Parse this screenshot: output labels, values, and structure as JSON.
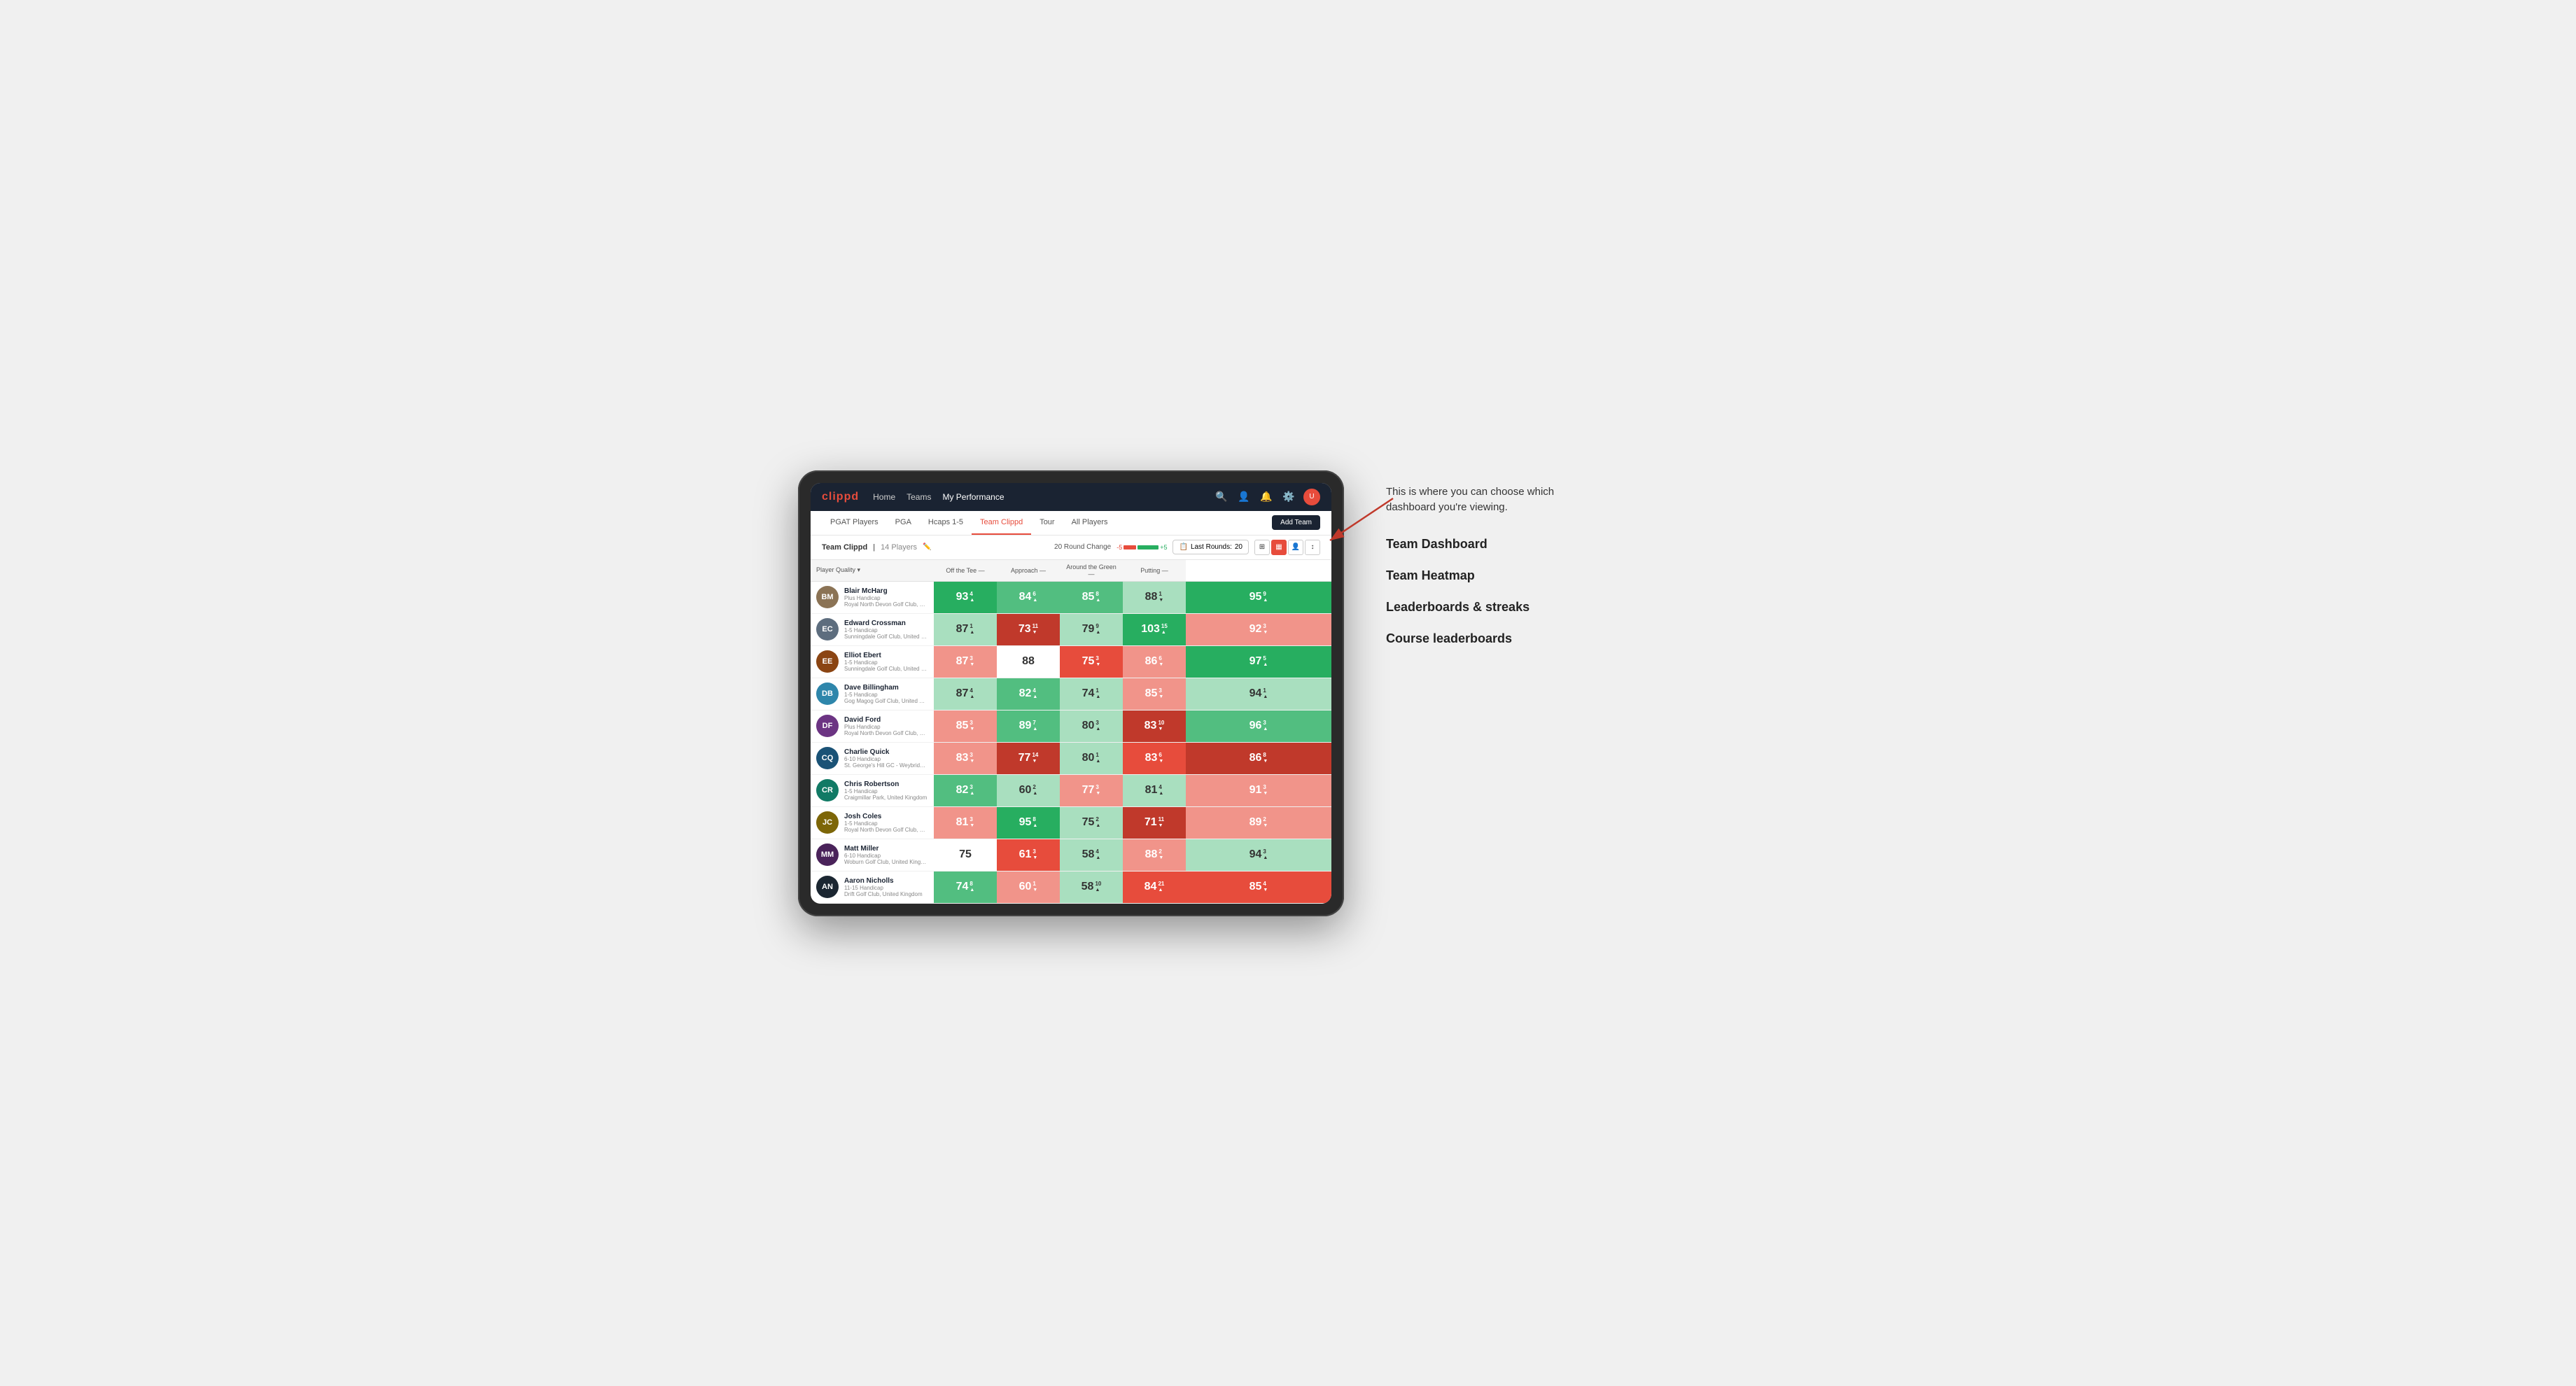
{
  "annotation": {
    "intro": "This is where you can choose which dashboard you're viewing.",
    "items": [
      "Team Dashboard",
      "Team Heatmap",
      "Leaderboards & streaks",
      "Course leaderboards"
    ]
  },
  "nav": {
    "logo": "clippd",
    "links": [
      "Home",
      "Teams",
      "My Performance"
    ],
    "active_link": "My Performance"
  },
  "sub_nav": {
    "items": [
      "PGAT Players",
      "PGA",
      "Hcaps 1-5",
      "Team Clippd",
      "Tour",
      "All Players"
    ],
    "active": "Team Clippd",
    "add_team": "Add Team"
  },
  "team_header": {
    "name": "Team Clippd",
    "separator": "|",
    "count": "14 Players",
    "round_change_label": "20 Round Change",
    "neg_val": "-5",
    "pos_val": "+5",
    "last_rounds_label": "Last Rounds:",
    "last_rounds_val": "20"
  },
  "table": {
    "columns": [
      "Player Quality ▾",
      "Off the Tee —",
      "Approach —",
      "Around the Green —",
      "Putting —"
    ],
    "rows": [
      {
        "name": "Blair McHarg",
        "handicap": "Plus Handicap",
        "club": "Royal North Devon Golf Club, United Kingdom",
        "avatar_color": "#8B7355",
        "initials": "BM",
        "metrics": [
          {
            "value": "93",
            "change": "4",
            "dir": "up",
            "bg": "green-strong"
          },
          {
            "value": "84",
            "change": "6",
            "dir": "up",
            "bg": "green-medium"
          },
          {
            "value": "85",
            "change": "8",
            "dir": "up",
            "bg": "green-medium"
          },
          {
            "value": "88",
            "change": "1",
            "dir": "down",
            "bg": "green-light"
          },
          {
            "value": "95",
            "change": "9",
            "dir": "up",
            "bg": "green-strong"
          }
        ]
      },
      {
        "name": "Edward Crossman",
        "handicap": "1-5 Handicap",
        "club": "Sunningdale Golf Club, United Kingdom",
        "avatar_color": "#5D6D7E",
        "initials": "EC",
        "metrics": [
          {
            "value": "87",
            "change": "1",
            "dir": "up",
            "bg": "green-light"
          },
          {
            "value": "73",
            "change": "11",
            "dir": "down",
            "bg": "red-strong"
          },
          {
            "value": "79",
            "change": "9",
            "dir": "up",
            "bg": "green-light"
          },
          {
            "value": "103",
            "change": "15",
            "dir": "up",
            "bg": "green-strong"
          },
          {
            "value": "92",
            "change": "3",
            "dir": "down",
            "bg": "red-light"
          }
        ]
      },
      {
        "name": "Elliot Ebert",
        "handicap": "1-5 Handicap",
        "club": "Sunningdale Golf Club, United Kingdom",
        "avatar_color": "#8B4513",
        "initials": "EE",
        "metrics": [
          {
            "value": "87",
            "change": "3",
            "dir": "down",
            "bg": "red-light"
          },
          {
            "value": "88",
            "change": "",
            "dir": "none",
            "bg": "white"
          },
          {
            "value": "75",
            "change": "3",
            "dir": "down",
            "bg": "red-medium"
          },
          {
            "value": "86",
            "change": "6",
            "dir": "down",
            "bg": "red-light"
          },
          {
            "value": "97",
            "change": "5",
            "dir": "up",
            "bg": "green-strong"
          }
        ]
      },
      {
        "name": "Dave Billingham",
        "handicap": "1-5 Handicap",
        "club": "Gog Magog Golf Club, United Kingdom",
        "avatar_color": "#2E86AB",
        "initials": "DB",
        "metrics": [
          {
            "value": "87",
            "change": "4",
            "dir": "up",
            "bg": "green-light"
          },
          {
            "value": "82",
            "change": "4",
            "dir": "up",
            "bg": "green-medium"
          },
          {
            "value": "74",
            "change": "1",
            "dir": "up",
            "bg": "green-light"
          },
          {
            "value": "85",
            "change": "3",
            "dir": "down",
            "bg": "red-light"
          },
          {
            "value": "94",
            "change": "1",
            "dir": "up",
            "bg": "green-light"
          }
        ]
      },
      {
        "name": "David Ford",
        "handicap": "Plus Handicap",
        "club": "Royal North Devon Golf Club, United Kingdom",
        "avatar_color": "#6C3483",
        "initials": "DF",
        "metrics": [
          {
            "value": "85",
            "change": "3",
            "dir": "down",
            "bg": "red-light"
          },
          {
            "value": "89",
            "change": "7",
            "dir": "up",
            "bg": "green-medium"
          },
          {
            "value": "80",
            "change": "3",
            "dir": "up",
            "bg": "green-light"
          },
          {
            "value": "83",
            "change": "10",
            "dir": "down",
            "bg": "red-strong"
          },
          {
            "value": "96",
            "change": "3",
            "dir": "up",
            "bg": "green-medium"
          }
        ]
      },
      {
        "name": "Charlie Quick",
        "handicap": "6-10 Handicap",
        "club": "St. George's Hill GC - Weybridge, Surrey, Uni...",
        "avatar_color": "#1A5276",
        "initials": "CQ",
        "metrics": [
          {
            "value": "83",
            "change": "3",
            "dir": "down",
            "bg": "red-light"
          },
          {
            "value": "77",
            "change": "14",
            "dir": "down",
            "bg": "red-strong"
          },
          {
            "value": "80",
            "change": "1",
            "dir": "up",
            "bg": "green-light"
          },
          {
            "value": "83",
            "change": "6",
            "dir": "down",
            "bg": "red-medium"
          },
          {
            "value": "86",
            "change": "8",
            "dir": "down",
            "bg": "red-strong"
          }
        ]
      },
      {
        "name": "Chris Robertson",
        "handicap": "1-5 Handicap",
        "club": "Craigmillar Park, United Kingdom",
        "avatar_color": "#117A65",
        "initials": "CR",
        "metrics": [
          {
            "value": "82",
            "change": "3",
            "dir": "up",
            "bg": "green-medium"
          },
          {
            "value": "60",
            "change": "2",
            "dir": "up",
            "bg": "green-light"
          },
          {
            "value": "77",
            "change": "3",
            "dir": "down",
            "bg": "red-light"
          },
          {
            "value": "81",
            "change": "4",
            "dir": "up",
            "bg": "green-light"
          },
          {
            "value": "91",
            "change": "3",
            "dir": "down",
            "bg": "red-light"
          }
        ]
      },
      {
        "name": "Josh Coles",
        "handicap": "1-5 Handicap",
        "club": "Royal North Devon Golf Club, United Kingdom",
        "avatar_color": "#7D6608",
        "initials": "JC",
        "metrics": [
          {
            "value": "81",
            "change": "3",
            "dir": "down",
            "bg": "red-light"
          },
          {
            "value": "95",
            "change": "8",
            "dir": "up",
            "bg": "green-strong"
          },
          {
            "value": "75",
            "change": "2",
            "dir": "up",
            "bg": "green-light"
          },
          {
            "value": "71",
            "change": "11",
            "dir": "down",
            "bg": "red-strong"
          },
          {
            "value": "89",
            "change": "2",
            "dir": "down",
            "bg": "red-light"
          }
        ]
      },
      {
        "name": "Matt Miller",
        "handicap": "6-10 Handicap",
        "club": "Woburn Golf Club, United Kingdom",
        "avatar_color": "#4A235A",
        "initials": "MM",
        "metrics": [
          {
            "value": "75",
            "change": "",
            "dir": "none",
            "bg": "white"
          },
          {
            "value": "61",
            "change": "3",
            "dir": "down",
            "bg": "red-medium"
          },
          {
            "value": "58",
            "change": "4",
            "dir": "up",
            "bg": "green-light"
          },
          {
            "value": "88",
            "change": "2",
            "dir": "down",
            "bg": "red-light"
          },
          {
            "value": "94",
            "change": "3",
            "dir": "up",
            "bg": "green-light"
          }
        ]
      },
      {
        "name": "Aaron Nicholls",
        "handicap": "11-15 Handicap",
        "club": "Drift Golf Club, United Kingdom",
        "avatar_color": "#1B2631",
        "initials": "AN",
        "metrics": [
          {
            "value": "74",
            "change": "8",
            "dir": "up",
            "bg": "green-medium"
          },
          {
            "value": "60",
            "change": "1",
            "dir": "down",
            "bg": "red-light"
          },
          {
            "value": "58",
            "change": "10",
            "dir": "up",
            "bg": "green-light"
          },
          {
            "value": "84",
            "change": "21",
            "dir": "up",
            "bg": "red-medium"
          },
          {
            "value": "85",
            "change": "4",
            "dir": "down",
            "bg": "red-medium"
          }
        ]
      }
    ]
  }
}
